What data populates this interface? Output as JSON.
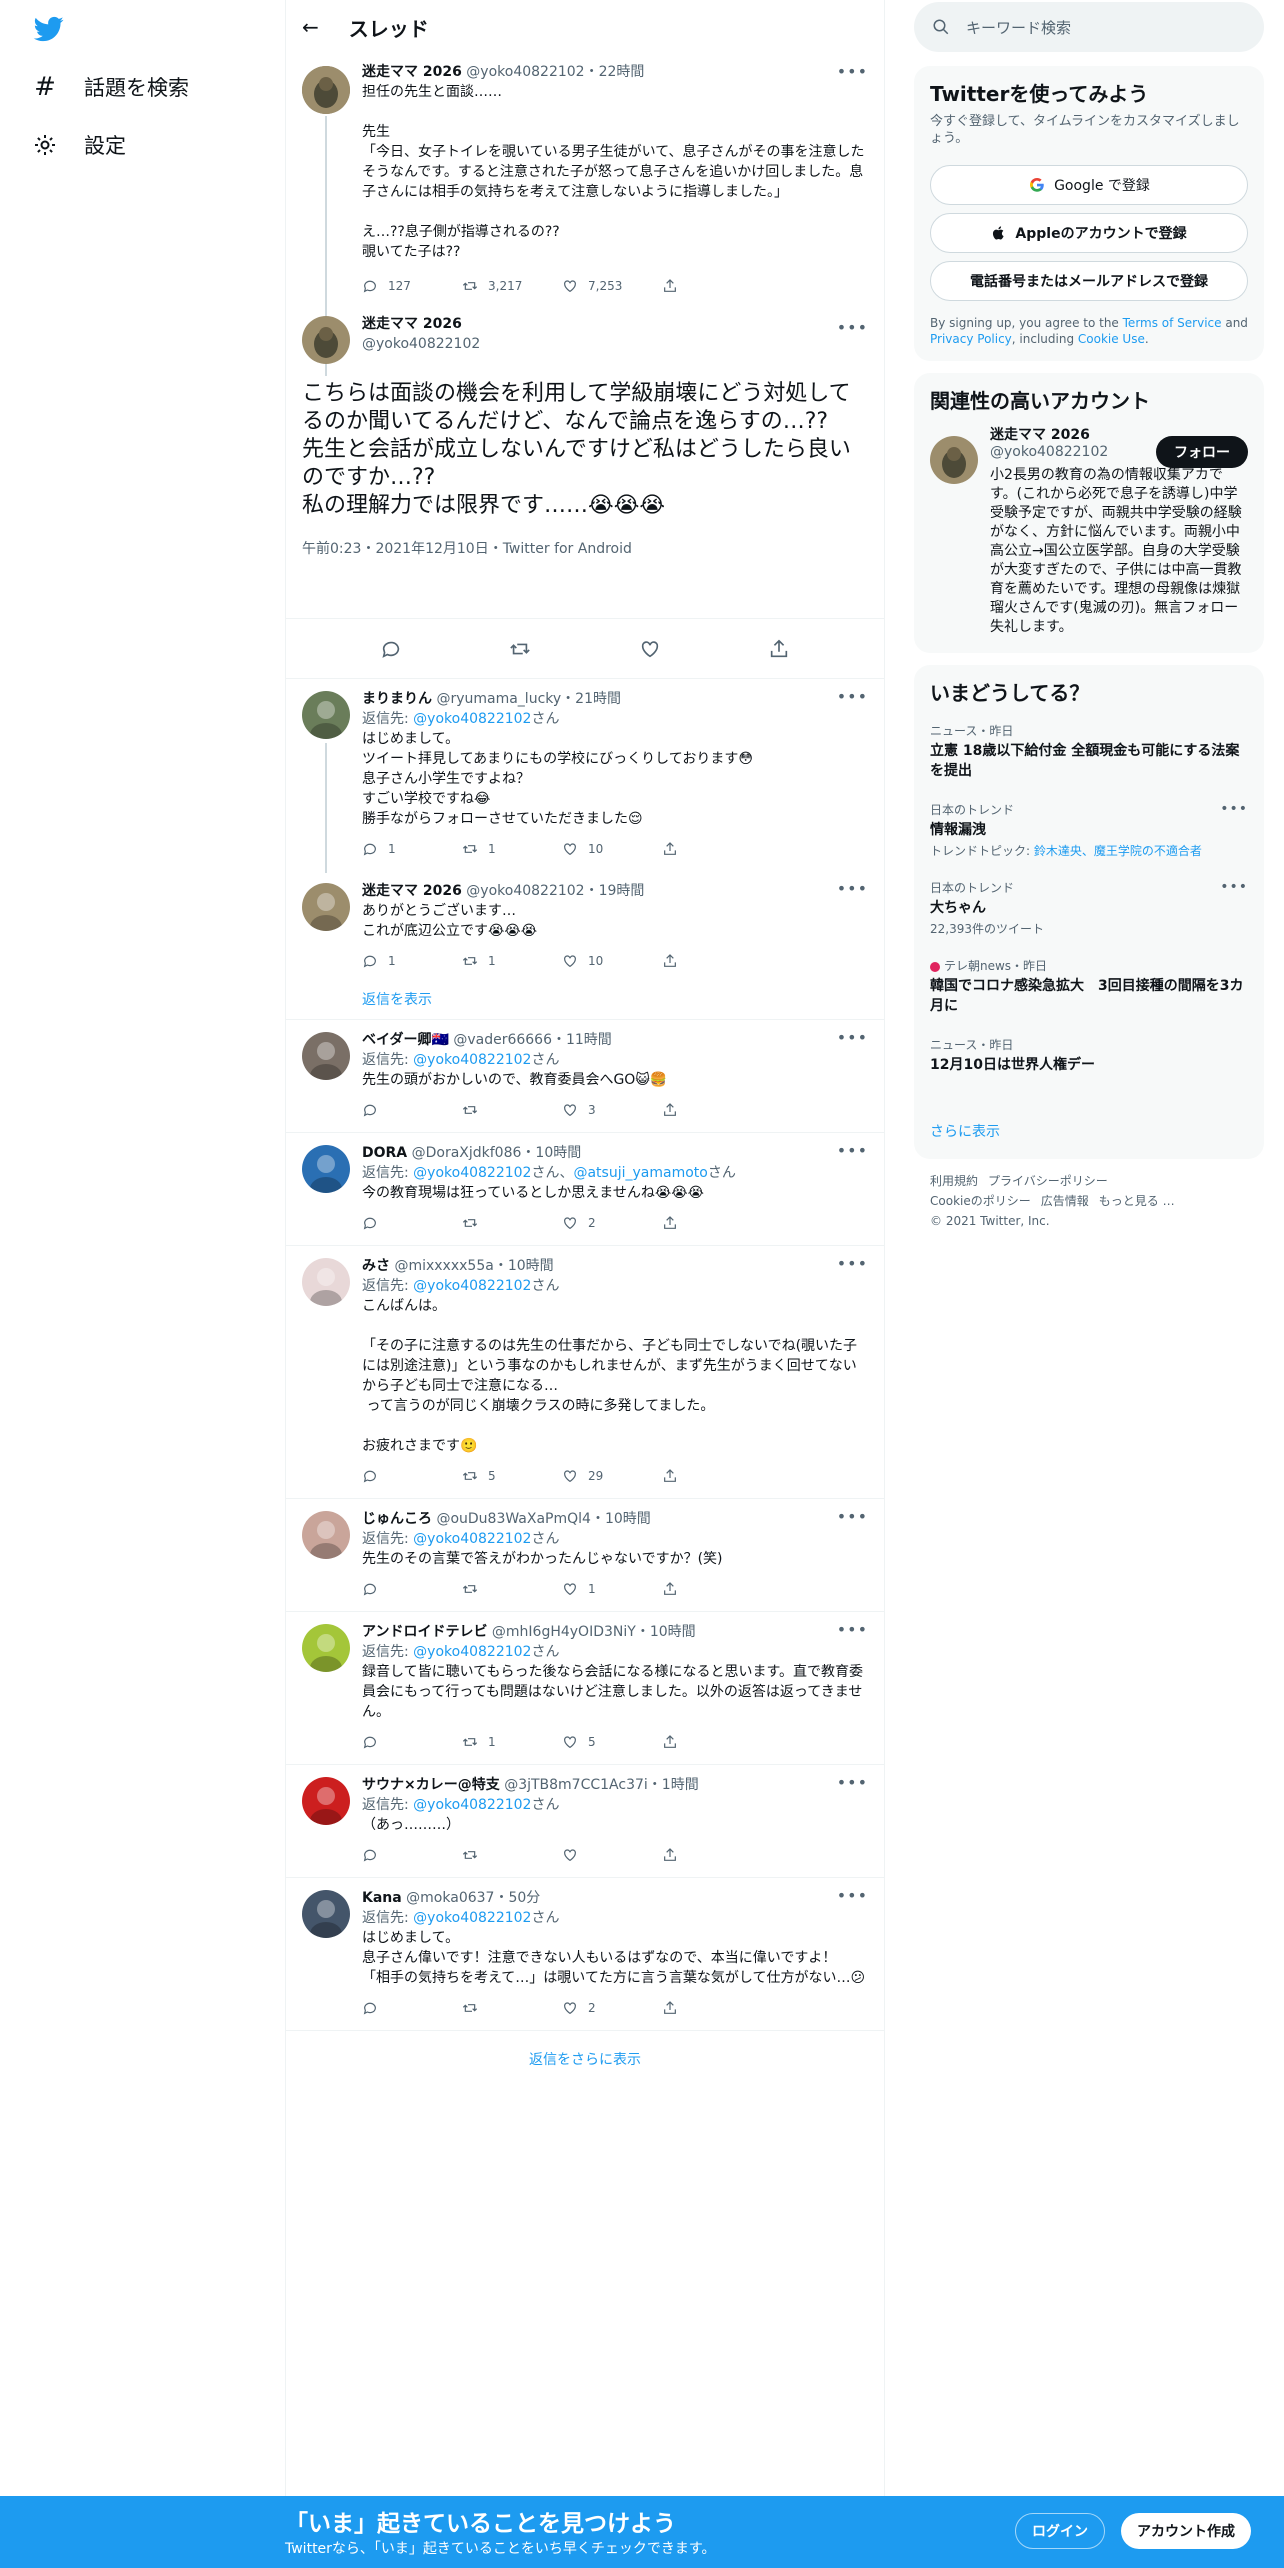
{
  "nav": {
    "explore_label": "話題を検索",
    "settings_label": "設定"
  },
  "thread": {
    "title": "スレッド",
    "parent": {
      "name": "迷走ママ 2026",
      "handle": "@yoko40822102",
      "time": "22時間",
      "text": "担任の先生と面談……\n\n先生\n「今日、女子トイレを覗いている男子生徒がいて、息子さんがその事を注意したそうなんです。すると注意された子が怒って息子さんを追いかけ回しました。息子さんには相手の気持ちを考えて注意しないように指導しました。」\n\nえ…??息子側が指導されるの??\n覗いてた子は??",
      "replies": "127",
      "retweets": "3,217",
      "likes": "7,253"
    },
    "focus": {
      "name": "迷走ママ 2026",
      "handle": "@yoko40822102",
      "text": "こちらは面談の機会を利用して学級崩壊にどう対処してるのか聞いてるんだけど、なんで論点を逸らすの…??\n先生と会話が成立しないんですけど私はどうしたら良いのですか…??\n私の理解力では限界です……😭😭😭",
      "meta": "午前0:23・2021年12月10日・Twitter for Android"
    },
    "replies": [
      {
        "name": "まりまりん",
        "handle": "@ryumama_lucky",
        "time": "21時間",
        "reply_to": "@yoko40822102",
        "text": "はじめまして。\nツイート拝見してあまりにもの学校にびっくりしております😳\n息子さん小学生ですよね？\nすごい学校ですね😂\n勝手ながらフォローさせていただきました😌",
        "r": "1",
        "rt": "1",
        "l": "10"
      },
      {
        "name": "迷走ママ 2026",
        "handle": "@yoko40822102",
        "time": "19時間",
        "text": "ありがとうございます…\nこれが底辺公立です😭😭😭",
        "r": "1",
        "rt": "1",
        "l": "10"
      },
      {
        "name": "ベイダー卿🇦🇺",
        "handle": "@vader66666",
        "time": "11時間",
        "reply_to": "@yoko40822102",
        "text": "先生の頭がおかしいので、教育委員会へGO😺🍔",
        "r": "",
        "rt": "",
        "l": "3"
      },
      {
        "name": "DORA",
        "handle": "@DoraXjdkf086",
        "time": "10時間",
        "reply_to": "@yoko40822102",
        "reply_to2": "@atsuji_yamamoto",
        "text": "今の教育現場は狂っているとしか思えませんね😭😭😭",
        "r": "",
        "rt": "",
        "l": "2"
      },
      {
        "name": "みさ",
        "handle": "@mixxxxx55a",
        "time": "10時間",
        "reply_to": "@yoko40822102",
        "text": "こんばんは。\n\n「その子に注意するのは先生の仕事だから、子ども同士でしないでね(覗いた子には別途注意)」という事なのかもしれませんが、まず先生がうまく回せてないから子ども同士で注意になる…\n って言うのが同じく崩壊クラスの時に多発してました。\n\nお疲れさまです🙂",
        "r": "",
        "rt": "5",
        "l": "29"
      },
      {
        "name": "じゅんころ",
        "handle": "@ouDu83WaXaPmQl4",
        "time": "10時間",
        "reply_to": "@yoko40822102",
        "text": "先生のその言葉で答えがわかったんじゃないですか？(笑)",
        "r": "",
        "rt": "",
        "l": "1"
      },
      {
        "name": "アンドロイドテレビ",
        "handle": "@mhI6gH4yOID3NiY",
        "time": "10時間",
        "reply_to": "@yoko40822102",
        "text": "録音して皆に聴いてもらった後なら会話になる様になると思います。直で教育委員会にもって行っても問題はないけど注意しました。以外の返答は返ってきません。",
        "r": "",
        "rt": "1",
        "l": "5"
      },
      {
        "name": "サウナ×カレー@特支",
        "handle": "@3jTB8m7CC1Ac37i",
        "time": "1時間",
        "reply_to": "@yoko40822102",
        "text": "（あっ………）",
        "r": "",
        "rt": "",
        "l": ""
      },
      {
        "name": "Kana",
        "handle": "@moka0637",
        "time": "50分",
        "reply_to": "@yoko40822102",
        "text": "はじめまして。\n息子さん偉いです！注意できない人もいるはずなので、本当に偉いですよ！\n「相手の気持ちを考えて…」は覗いてた方に言う言葉な気がして仕方がない…😕",
        "r": "",
        "rt": "",
        "l": "2"
      }
    ],
    "show_replies": "返信を表示",
    "show_more_replies": "返信をさらに表示",
    "reply_prefix": "返信先: ",
    "reply_suffix": "さん",
    "reply_sep": "さん、"
  },
  "search": {
    "placeholder": "キーワード検索"
  },
  "signup": {
    "title": "Twitterを使ってみよう",
    "sub": "今すぐ登録して、タイムラインをカスタマイズしましょう。",
    "google": "Google で登録",
    "apple": "Appleのアカウントで登録",
    "email": "電話番号またはメールアドレスで登録",
    "terms_1": "By signing up, you agree to the ",
    "terms_link1": "Terms of Service",
    "terms_2": " and ",
    "terms_link2": "Privacy Policy",
    "terms_3": ", including ",
    "terms_link3": "Cookie Use",
    "terms_4": "."
  },
  "related": {
    "title": "関連性の高いアカウント",
    "name": "迷走ママ 2026",
    "handle": "@yoko40822102",
    "follow": "フォロー",
    "bio": "小2長男の教育の為の情報収集アカです。(これから必死で息子を誘導し)中学受験予定ですが、両親共中学受験の経験がなく、方針に悩んでいます。両親小中高公立→国公立医学部。自身の大学受験が大変すぎたので、子供には中高一貫教育を薦めたいです。理想の母親像は煉獄瑠火さんです(鬼滅の刃)。無言フォロー失礼します。"
  },
  "trends": {
    "title": "いまどうしてる？",
    "items": [
      {
        "meta": "ニュース・昨日",
        "name": "立憲 18歳以下給付金 全額現金も可能にする法案を提出",
        "extra": ""
      },
      {
        "meta": "日本のトレンド",
        "name": "情報漏洩",
        "extra": "トレンドトピック: ",
        "extra_link": "鈴木達央、魔王学院の不適合者"
      },
      {
        "meta": "日本のトレンド",
        "name": "大ちゃん",
        "extra": "22,393件のツイート"
      },
      {
        "meta": "テレ朝news・昨日",
        "name": "韓国でコロナ感染急拡大　3回目接種の間隔を3カ月に",
        "extra": ""
      },
      {
        "meta": "ニュース・昨日",
        "name": "12月10日は世界人権デー",
        "extra": ""
      }
    ],
    "show_more": "さらに表示"
  },
  "footer": {
    "links": [
      "利用規約",
      "プライバシーポリシー",
      "Cookieのポリシー",
      "広告情報",
      "もっと見る …"
    ],
    "copyright": "© 2021 Twitter, Inc."
  },
  "bottom": {
    "headline": "「いま」起きていることを見つけよう",
    "sub": "Twitterなら、「いま」起きていることをいち早くチェックできます。",
    "login": "ログイン",
    "signup": "アカウント作成"
  },
  "colors": {
    "accent": "#1d9bf0",
    "text": "#0f1419",
    "muted": "#536471"
  }
}
